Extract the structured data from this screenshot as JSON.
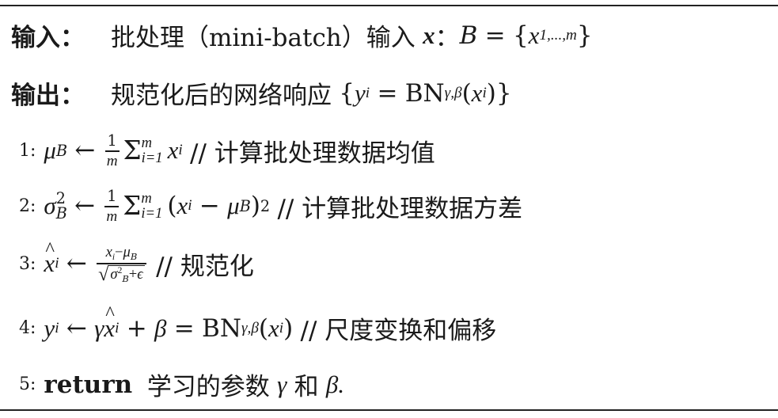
{
  "input": {
    "label": "输入：",
    "text_pre": "批处理（mini-batch）输入",
    "var_x": "x",
    "colon": "：",
    "set_lhs": "B",
    "set_eq": "=",
    "set_rhs_open": "{",
    "set_x": "x",
    "set_sub": "1,...,m",
    "set_rhs_close": "}"
  },
  "output": {
    "label": "输出：",
    "text_pre": "规范化后的网络响应",
    "open": "{",
    "y": "y",
    "i": "i",
    "eq": "=",
    "bn": "BN",
    "bn_sub": "γ,β",
    "arg_open": "(",
    "arg_x": "x",
    "arg_i": "i",
    "arg_close": ")",
    "close": "}"
  },
  "steps": [
    {
      "num": "1:",
      "comment": "// 计算批处理数据均值"
    },
    {
      "num": "2:",
      "comment": "// 计算批处理数据方差"
    },
    {
      "num": "3:",
      "comment": "// 规范化"
    },
    {
      "num": "4:",
      "comment": "// 尺度变换和偏移"
    },
    {
      "num": "5:",
      "return_kw": "return",
      "text": "学习的参数",
      "gamma": "γ",
      "and": "和",
      "beta": "β."
    }
  ],
  "math": {
    "mu": "μ",
    "B": "B",
    "arrow": "←",
    "one": "1",
    "m": "m",
    "sigma": "Σ",
    "sum_top": "m",
    "sum_bot": "i=1",
    "x": "x",
    "i": "i",
    "sigma_var": "σ",
    "two": "2",
    "lparen": "(",
    "rparen": ")",
    "minus": "−",
    "plus": "+",
    "eps": "ϵ",
    "radical": "√",
    "y": "y",
    "gamma": "γ",
    "beta": "β",
    "eq": "=",
    "bn": "BN",
    "bn_sub": "γ,β"
  }
}
